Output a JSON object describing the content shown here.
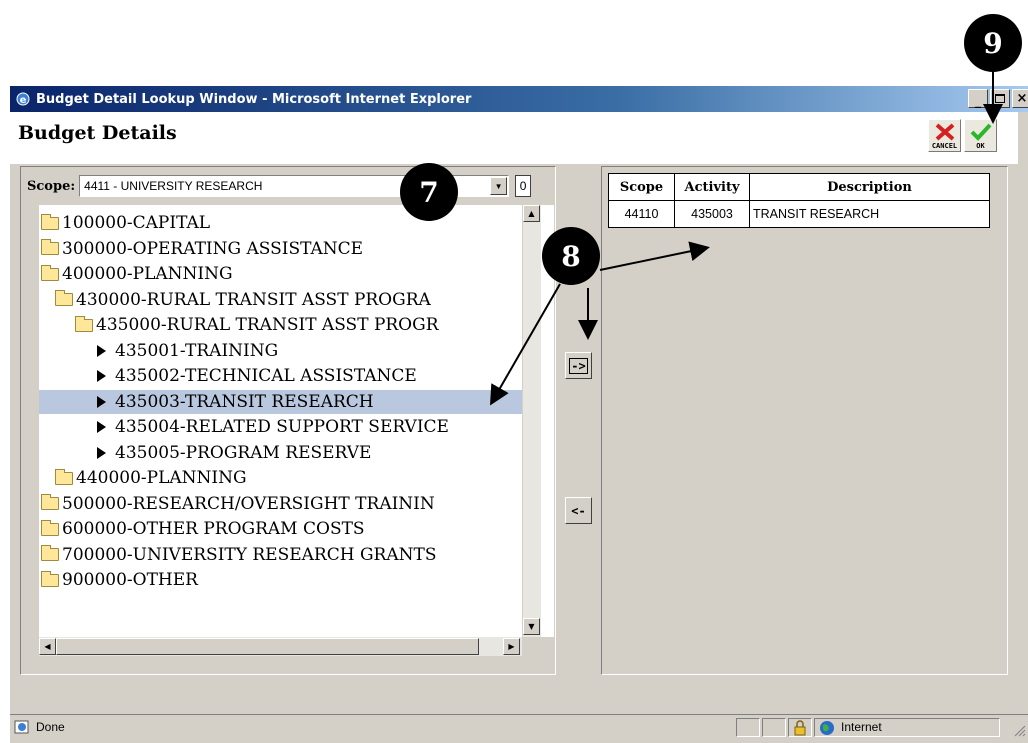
{
  "window": {
    "title": "Budget Detail Lookup Window - Microsoft Internet Explorer"
  },
  "page": {
    "title": "Budget Details",
    "cancel_label": "CANCEL",
    "ok_label": "OK"
  },
  "scope": {
    "label": "Scope:",
    "selected": "4411 - UNIVERSITY RESEARCH",
    "count": "0"
  },
  "tree": {
    "items": [
      {
        "label": "100000-CAPITAL",
        "kind": "folder",
        "level": 0
      },
      {
        "label": "300000-OPERATING ASSISTANCE",
        "kind": "folder",
        "level": 0
      },
      {
        "label": "400000-PLANNING",
        "kind": "folder",
        "level": 0
      },
      {
        "label": "430000-RURAL TRANSIT ASST PROGRA",
        "kind": "folder",
        "level": 1
      },
      {
        "label": "435000-RURAL TRANSIT ASST PROGR",
        "kind": "folder-open",
        "level": 2
      },
      {
        "label": "435001-TRAINING",
        "kind": "leaf",
        "level": 3
      },
      {
        "label": "435002-TECHNICAL ASSISTANCE",
        "kind": "leaf",
        "level": 3
      },
      {
        "label": "435003-TRANSIT RESEARCH",
        "kind": "leaf",
        "level": 3,
        "selected": true
      },
      {
        "label": "435004-RELATED SUPPORT SERVICE",
        "kind": "leaf",
        "level": 3
      },
      {
        "label": "435005-PROGRAM RESERVE",
        "kind": "leaf",
        "level": 3
      },
      {
        "label": "440000-PLANNING",
        "kind": "folder",
        "level": 1
      },
      {
        "label": "500000-RESEARCH/OVERSIGHT TRAININ",
        "kind": "folder",
        "level": 0
      },
      {
        "label": "600000-OTHER PROGRAM COSTS",
        "kind": "folder",
        "level": 0
      },
      {
        "label": "700000-UNIVERSITY RESEARCH GRANTS",
        "kind": "folder",
        "level": 0
      },
      {
        "label": "900000-OTHER",
        "kind": "folder",
        "level": 0
      }
    ]
  },
  "move_buttons": {
    "add_label": "->",
    "remove_label": "<-"
  },
  "selected_table": {
    "headers": [
      "Scope",
      "Activity",
      "Description"
    ],
    "rows": [
      [
        "44110",
        "435003",
        "TRANSIT RESEARCH"
      ]
    ]
  },
  "status": {
    "text": "Done",
    "zone": "Internet"
  },
  "callouts": {
    "seven": "7",
    "eight": "8",
    "nine": "9"
  },
  "colors": {
    "titlebar": "#0a246a",
    "selected_row": "#b9c8de",
    "chrome": "#d4d0c8"
  }
}
